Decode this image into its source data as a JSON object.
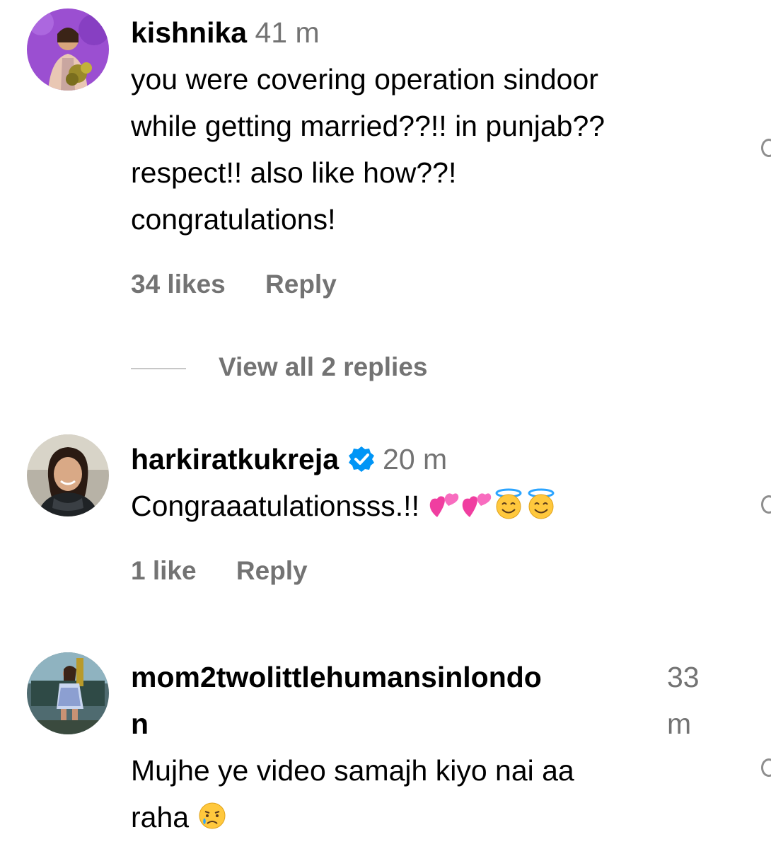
{
  "comments": [
    {
      "username": "kishnika",
      "time": "41 m",
      "text_lines": [
        "you were covering operation sindoor",
        "while getting married??!! in punjab??",
        "respect!! also like how??!",
        "congratulations!"
      ],
      "likes": "34 likes",
      "reply": "Reply",
      "view_replies": "View all 2 replies"
    },
    {
      "username": "harkiratkukreja",
      "verified": true,
      "time": "20 m",
      "text": "Congraaatulationsss.!!",
      "emojis": [
        "heart-icon",
        "heart-icon",
        "smiling-halo-icon",
        "smiling-halo-icon"
      ],
      "likes": "1 like",
      "reply": "Reply"
    },
    {
      "username_line1": "mom2twolittlehumansinlondo",
      "username_line2": "n",
      "time_line1": "33",
      "time_line2": "m",
      "text_line1": "Mujhe ye video samajh kiyo nai aa",
      "text_line2": "raha",
      "emoji": "crying-face-icon"
    }
  ],
  "colors": {
    "text": "#000000",
    "secondary": "#737373",
    "verified": "#0095f6",
    "divider": "#c7c7c7"
  }
}
